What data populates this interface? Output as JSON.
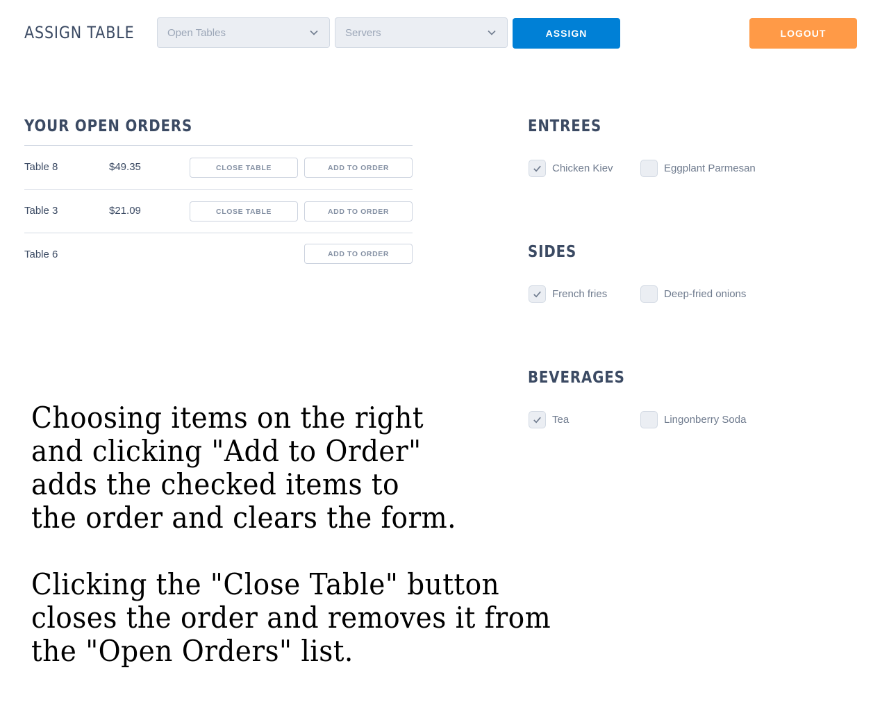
{
  "header": {
    "title": "ASSIGN TABLE",
    "tables_select": {
      "placeholder": "Open Tables",
      "icon": "chevron-down-icon"
    },
    "servers_select": {
      "placeholder": "Servers",
      "icon": "chevron-down-icon"
    },
    "assign_label": "ASSIGN",
    "logout_label": "LOGOUT"
  },
  "orders": {
    "title": "YOUR OPEN ORDERS",
    "rows": [
      {
        "table": "Table 8",
        "total": "$49.35",
        "close_label": "CLOSE TABLE",
        "add_label": "ADD TO ORDER"
      },
      {
        "table": "Table 3",
        "total": "$21.09",
        "close_label": "CLOSE TABLE",
        "add_label": "ADD TO ORDER"
      },
      {
        "table": "Table 6",
        "total": "",
        "add_label": "ADD TO ORDER"
      }
    ]
  },
  "menu": {
    "entrees": {
      "title": "ENTREES",
      "items": [
        {
          "label": "Chicken Kiev",
          "checked": true
        },
        {
          "label": "Eggplant Parmesan",
          "checked": false
        }
      ]
    },
    "sides": {
      "title": "SIDES",
      "items": [
        {
          "label": "French fries",
          "checked": true
        },
        {
          "label": "Deep-fried onions",
          "checked": false
        }
      ]
    },
    "beverages": {
      "title": "BEVERAGES",
      "items": [
        {
          "label": "Tea",
          "checked": true
        },
        {
          "label": "Lingonberry Soda",
          "checked": false
        }
      ]
    }
  },
  "instructions": {
    "paragraph1": "Choosing items on the right\nand clicking \"Add to Order\"\nadds the checked items to\nthe order and clears the form.",
    "paragraph2": "Clicking the \"Close Table\" button\ncloses the order and removes it from\nthe \"Open Orders\" list."
  },
  "colors": {
    "primary": "#0080d6",
    "logout": "#ff9a47",
    "text": "#3b4a63",
    "muted": "#8490a3",
    "input_bg": "#ebeef3"
  }
}
